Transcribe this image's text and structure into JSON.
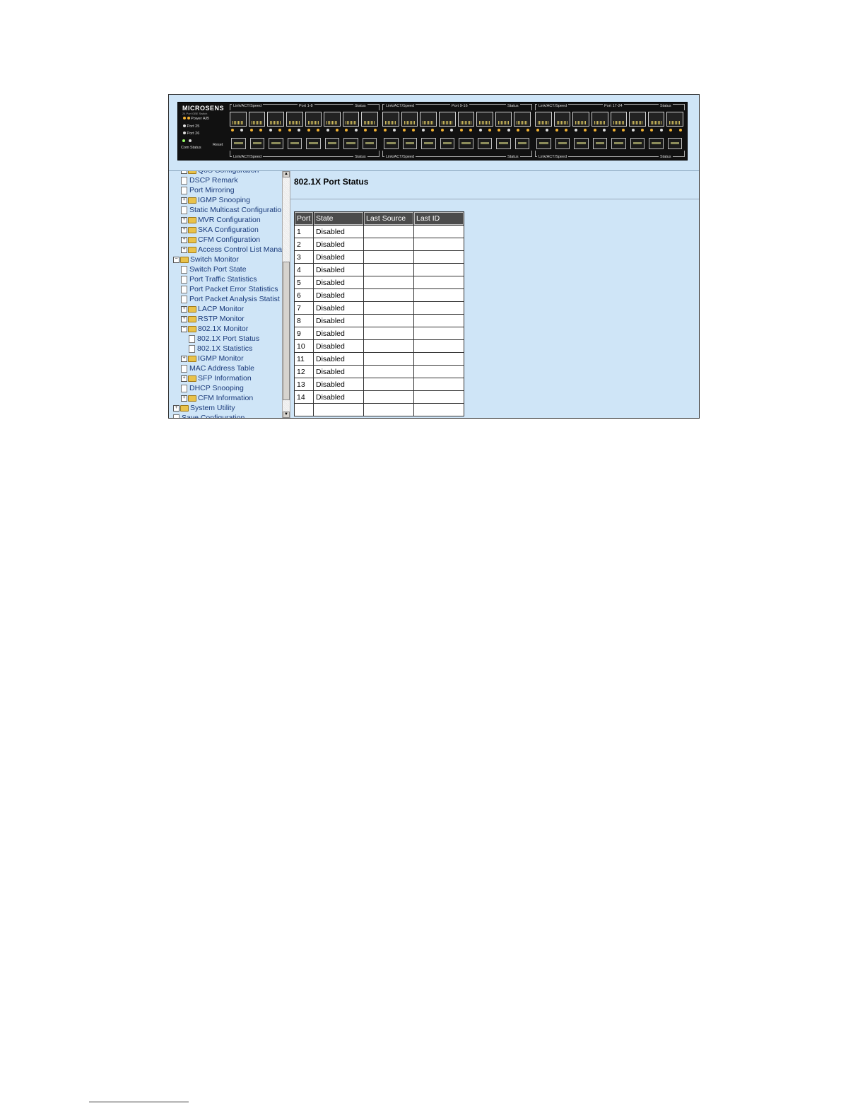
{
  "panel": {
    "brand": "MICROSENS",
    "brand_sub": "24 Port GBE Switch",
    "power_label": "Power A/B",
    "port25_label": "Port 25",
    "port26_label": "Port 26",
    "com_label": "Com",
    "status_label": "Status",
    "reset_label": "Reset",
    "groups": [
      {
        "link_label": "Link/ACT/Speed",
        "ports_label": "Port 1-8",
        "status_label": "Status",
        "bottom_link": "Link/ACT/Speed",
        "bottom_status": "Status"
      },
      {
        "link_label": "Link/ACT/Speed",
        "ports_label": "Port 9-16",
        "status_label": "Status",
        "bottom_link": "Link/ACT/Speed",
        "bottom_status": "Status"
      },
      {
        "link_label": "Link/ACT/Speed",
        "ports_label": "Port 17-24",
        "status_label": "Status",
        "bottom_link": "Link/ACT/Speed",
        "bottom_status": "Status"
      }
    ]
  },
  "tree": {
    "items": [
      {
        "label": "QoS Configuration",
        "type": "folder",
        "expanded": false
      },
      {
        "label": "DSCP Remark",
        "type": "doc"
      },
      {
        "label": "Port Mirroring",
        "type": "doc"
      },
      {
        "label": "IGMP Snooping",
        "type": "folder",
        "expanded": false
      },
      {
        "label": "Static Multicast Configuratio",
        "type": "doc"
      },
      {
        "label": "MVR Configuration",
        "type": "folder",
        "expanded": false
      },
      {
        "label": "SKA Configuration",
        "type": "folder",
        "expanded": false
      },
      {
        "label": "CFM Configuration",
        "type": "folder",
        "expanded": false
      },
      {
        "label": "Access Control List Manage",
        "type": "folder",
        "expanded": false
      },
      {
        "label": "Switch Monitor",
        "type": "folder",
        "expanded": true
      },
      {
        "label": "Switch Port State",
        "type": "doc"
      },
      {
        "label": "Port Traffic Statistics",
        "type": "doc"
      },
      {
        "label": "Port Packet Error Statistics",
        "type": "doc"
      },
      {
        "label": "Port Packet Analysis Statist",
        "type": "doc"
      },
      {
        "label": "LACP Monitor",
        "type": "folder",
        "expanded": false
      },
      {
        "label": "RSTP Monitor",
        "type": "folder",
        "expanded": false
      },
      {
        "label": "802.1X Monitor",
        "type": "folder",
        "expanded": true
      },
      {
        "label": "802.1X Port Status",
        "type": "doc"
      },
      {
        "label": "802.1X Statistics",
        "type": "doc"
      },
      {
        "label": "IGMP Monitor",
        "type": "folder",
        "expanded": false
      },
      {
        "label": "MAC Address Table",
        "type": "doc"
      },
      {
        "label": "SFP Information",
        "type": "folder",
        "expanded": false
      },
      {
        "label": "DHCP Snooping",
        "type": "doc"
      },
      {
        "label": "CFM Information",
        "type": "folder",
        "expanded": false
      },
      {
        "label": "System Utility",
        "type": "folder",
        "expanded": false
      },
      {
        "label": "Save Configuration",
        "type": "doc"
      }
    ]
  },
  "content": {
    "title": "802.1X Port Status",
    "table": {
      "headers": [
        "Port",
        "State",
        "Last Source",
        "Last ID"
      ],
      "rows": [
        [
          "1",
          "Disabled",
          "",
          ""
        ],
        [
          "2",
          "Disabled",
          "",
          ""
        ],
        [
          "3",
          "Disabled",
          "",
          ""
        ],
        [
          "4",
          "Disabled",
          "",
          ""
        ],
        [
          "5",
          "Disabled",
          "",
          ""
        ],
        [
          "6",
          "Disabled",
          "",
          ""
        ],
        [
          "7",
          "Disabled",
          "",
          ""
        ],
        [
          "8",
          "Disabled",
          "",
          ""
        ],
        [
          "9",
          "Disabled",
          "",
          ""
        ],
        [
          "10",
          "Disabled",
          "",
          ""
        ],
        [
          "11",
          "Disabled",
          "",
          ""
        ],
        [
          "12",
          "Disabled",
          "",
          ""
        ],
        [
          "13",
          "Disabled",
          "",
          ""
        ],
        [
          "14",
          "Disabled",
          "",
          ""
        ],
        [
          "",
          "",
          "",
          ""
        ]
      ]
    }
  },
  "colors": {
    "background": "#cfe5f7",
    "header_cell": "#4b4b4b",
    "tree_text": "#1a3a7a",
    "led_amber": "#f2b233"
  }
}
